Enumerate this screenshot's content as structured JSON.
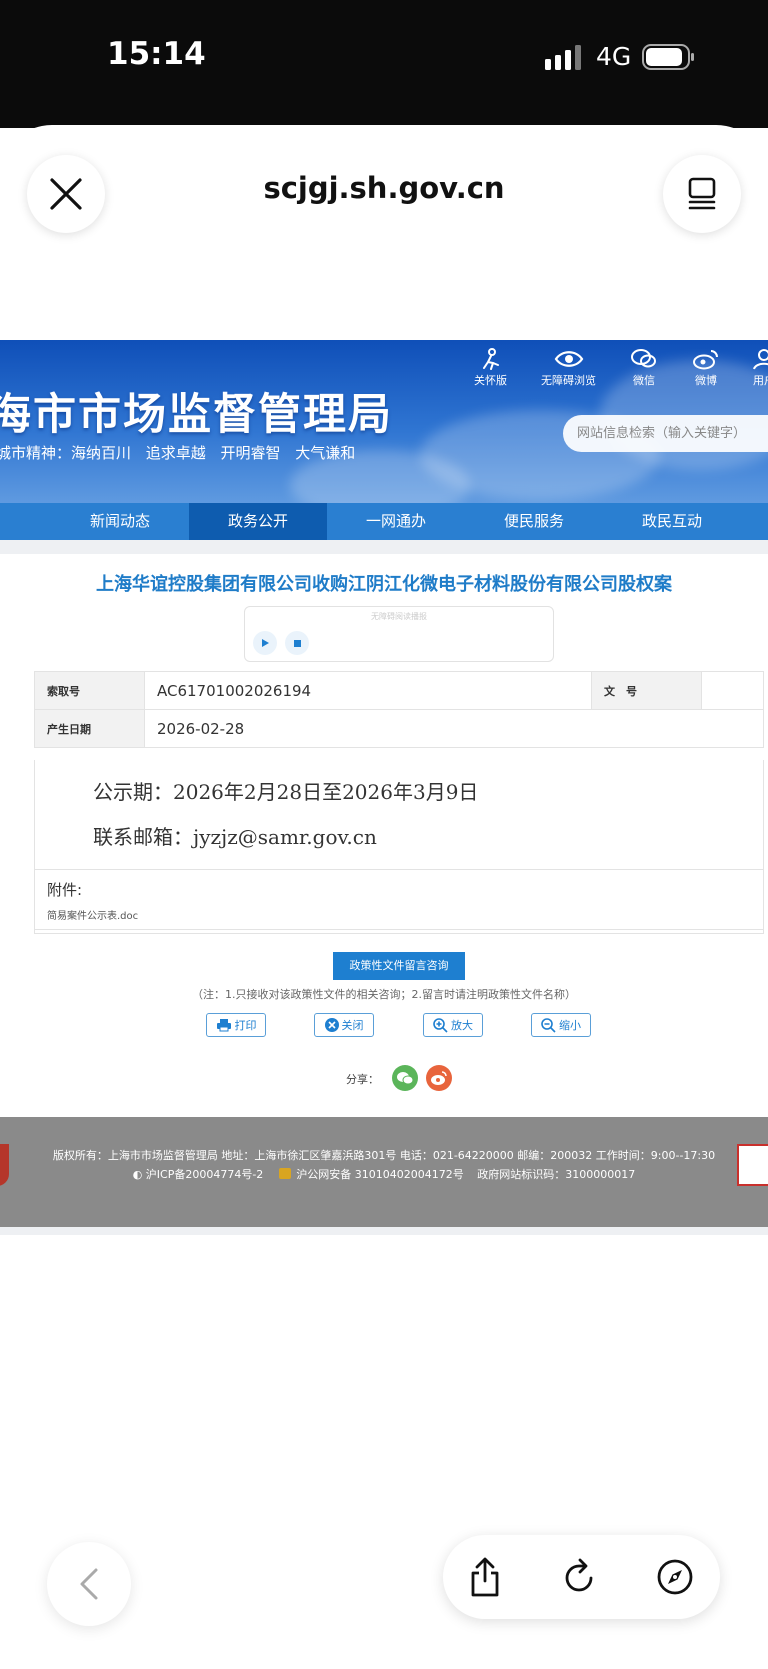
{
  "status_bar": {
    "time": "15:14",
    "network": "4G"
  },
  "browser": {
    "url": "scjgj.sh.gov.cn"
  },
  "site": {
    "title": "海市市场监督管理局",
    "motto": "城市精神：海纳百川 追求卓越 开明睿智 大气谦和",
    "tools": [
      {
        "label": "关怀版",
        "icon": "care-mode-icon"
      },
      {
        "label": "无障碍浏览",
        "icon": "eye-icon"
      },
      {
        "label": "微信",
        "icon": "wechat-icon"
      },
      {
        "label": "微博",
        "icon": "weibo-icon"
      },
      {
        "label": "用户",
        "icon": "user-icon"
      }
    ],
    "search_placeholder": "网站信息检索（输入关键字）",
    "nav": [
      "新闻动态",
      "政务公开",
      "一网通办",
      "便民服务",
      "政民互动"
    ],
    "active_nav": "政务公开"
  },
  "article": {
    "title": "上海华谊控股集团有限公司收购江阴江化微电子材料股份有限公司股权案",
    "audio_label": "无障碍阅读播报",
    "meta": {
      "index_label": "索取号",
      "index_value": "AC61701002026194",
      "doc_no_label": "文　号",
      "doc_no_value": "",
      "date_label": "产生日期",
      "date_value": "2026-02-28"
    },
    "body_lines": [
      "公示期：2026年2月28日至2026年3月9日",
      "联系邮箱：jyzjz@samr.gov.cn"
    ],
    "attachment_label": "附件:",
    "attachment_file": "简易案件公示表.doc",
    "consult_button": "政策性文件留言咨询",
    "consult_note": "（注：1.只接收对该政策性文件的相关咨询；2.留言时请注明政策性文件名称）",
    "actions": [
      "打印",
      "关闭",
      "放大",
      "缩小"
    ],
    "share_label": "分享："
  },
  "footer": {
    "line1": "版权所有：上海市市场监督管理局 地址：上海市徐汇区肇嘉浜路301号 电话：021-64220000 邮编：200032 工作时间：9:00--17:30",
    "icp": "沪ICP备20004774号-2",
    "police": "沪公网安备 31010402004172号",
    "site_code": "政府网站标识码：3100000017"
  },
  "colors": {
    "accent": "#1f7cc8",
    "nav": "#2a7fd1",
    "nav_active": "#0e5caf",
    "footer": "#8a8a8a"
  }
}
